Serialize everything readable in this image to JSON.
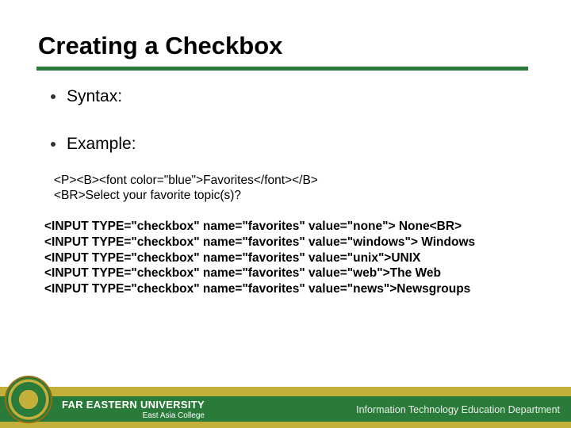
{
  "title": "Creating a Checkbox",
  "bullets": {
    "syntax": "Syntax:",
    "example": "Example:"
  },
  "code_block_1": {
    "line1": "<P><B><font color=\"blue\">Favorites</font></B>",
    "line2": "<BR>Select your favorite topic(s)?"
  },
  "code_block_2": {
    "line1": "<INPUT TYPE=\"checkbox\" name=\"favorites\" value=\"none\"> None<BR>",
    "line2": "<INPUT TYPE=\"checkbox\" name=\"favorites\" value=\"windows\"> Windows",
    "line3": "<INPUT TYPE=\"checkbox\" name=\"favorites\" value=\"unix\">UNIX",
    "line4": "<INPUT TYPE=\"checkbox\" name=\"favorites\" value=\"web\">The Web",
    "line5": "<INPUT TYPE=\"checkbox\" name=\"favorites\" value=\"news\">Newsgroups"
  },
  "footer": {
    "university": "FAR EASTERN UNIVERSITY",
    "college": "East Asia College",
    "department": "Information Technology Education Department"
  }
}
